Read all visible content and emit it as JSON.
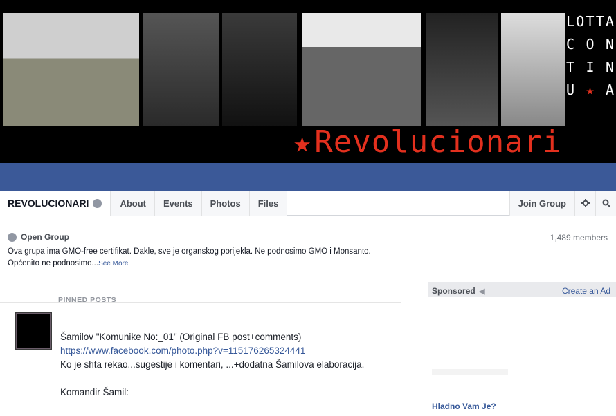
{
  "banner": {
    "slogan_rows": [
      [
        "L",
        "O",
        "T",
        "T",
        "A"
      ],
      [
        "C",
        "O",
        "N"
      ],
      [
        "T",
        "I",
        "N"
      ],
      [
        "U",
        "★",
        "A"
      ]
    ],
    "brand_star": "★",
    "brand_name": "Revolucionari",
    "accent_color": "#e3301e"
  },
  "tabs": {
    "group_name": "REVOLUCIONARI",
    "about": "About",
    "events": "Events",
    "photos": "Photos",
    "files": "Files",
    "join_group": "Join Group",
    "settings_icon": "gear-icon",
    "search_icon": "search-icon"
  },
  "about": {
    "privacy": "Open Group",
    "description": "Ova grupa ima GMO-free certifikat. Dakle, sve je organskog porijekla. Ne podnosimo GMO i Monsanto. Općenito ne podnosimo...",
    "see_more": "See More",
    "members": "1,489 members"
  },
  "pinned": {
    "label": "PINNED POSTS",
    "post": {
      "line1": "Šamilov \"Komunike No:_01\" (Original FB post+comments)",
      "link": "https://www.facebook.com/photo.php?v=115176265324441",
      "line3": "Ko je shta rekao...sugestije i komentari, ...+dodatna Šamilova elaboracija.",
      "line4": "Komandir Šamil:"
    }
  },
  "sidebar": {
    "sponsored": "Sponsored",
    "create_ad": "Create an Ad",
    "ad_title": "Hladno Vam Je?"
  }
}
